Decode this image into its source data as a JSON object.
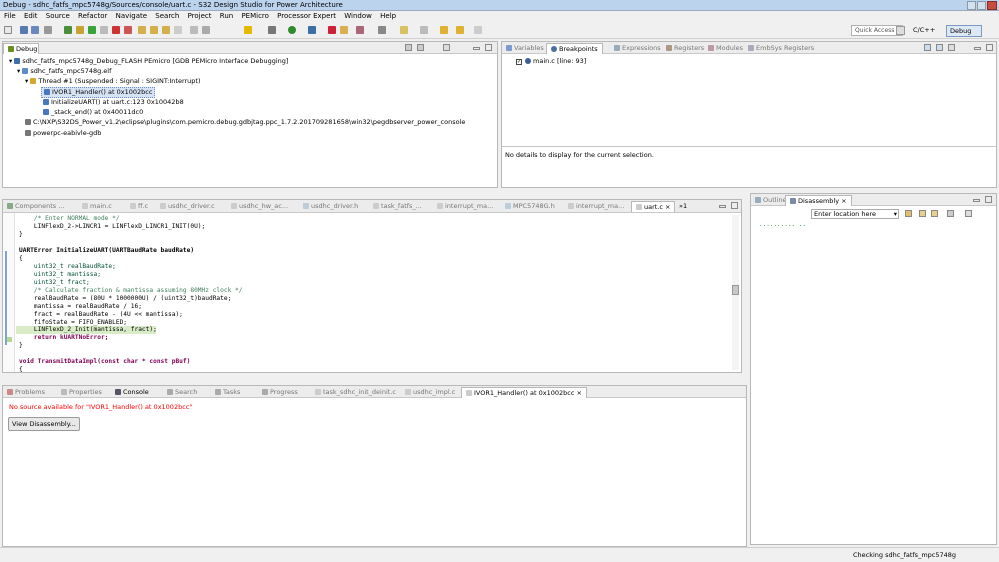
{
  "window": {
    "title": "Debug - sdhc_fatfs_mpc5748g/Sources/console/uart.c - S32 Design Studio for Power Architecture"
  },
  "menu": [
    "File",
    "Edit",
    "Source",
    "Refactor",
    "Navigate",
    "Search",
    "Project",
    "Run",
    "PEMicro",
    "Processor Expert",
    "Window",
    "Help"
  ],
  "toolbar": {
    "quick_access": "Quick Access",
    "perspectives": [
      "C/C++",
      "Debug"
    ]
  },
  "debug_view": {
    "tab": "Debug",
    "tree": [
      "sdhc_fatfs_mpc5748g_Debug_FLASH PEmicro [GDB PEMicro Interface Debugging]",
      "sdhc_fatfs_mpc5748g.elf",
      "Thread #1 (Suspended : Signal : SIGINT:Interrupt)",
      "IVOR1_Handler() at 0x1002bcc",
      "InitializeUART() at uart.c:123 0x10042b8",
      "_stack_end() at 0x40011dc0",
      "C:\\NXP\\S32DS_Power_v1.2\\eclipse\\plugins\\com.pemicro.debug.gdbjtag.ppc_1.7.2.201709281658\\win32\\pegdbserver_power_console",
      "powerpc-eabivle-gdb"
    ]
  },
  "right_top": {
    "tabs": [
      "Variables",
      "Breakpoints",
      "Expressions",
      "Registers",
      "Modules",
      "EmbSys Registers"
    ],
    "breakpoint": "main.c [line: 93]",
    "details": "No details to display for the current selection."
  },
  "editor": {
    "tabs": [
      "Components ...",
      "main.c",
      "ff.c",
      "usdhc_driver.c",
      "usdhc_hw_ac...",
      "usdhc_driver.h",
      "task_fatfs_...",
      "interrupt_ma...",
      "MPC5748G.h",
      "interrupt_ma...",
      "uart.c",
      "»1"
    ],
    "lines": [
      "    /* Enter NORMAL mode */",
      "    LINFlexD_2->LINCR1 = LINFlexD_LINCR1_INIT(0U);",
      "}",
      "",
      "UARTError InitializeUART(UARTBaudRate baudRate)",
      "{",
      "    uint32_t realBaudRate;",
      "    uint32_t mantissa;",
      "    uint32_t fract;",
      "    /* Calculate fraction & mantissa assuming 80MHz clock */",
      "    realBaudRate = (80U * 1000000U) / (uint32_t)baudRate;",
      "    mantissa = realBaudRate / 16;",
      "    fract = realBaudRate - (4U << mantissa);",
      "    fifoState = FIFO_ENABLED;",
      "    LINFlexD_2_Init(mantissa, fract);",
      "    return kUARTNoError;",
      "}",
      "",
      "void TransmitDataImpl(const char * const pBuf)",
      "{"
    ]
  },
  "outline": {
    "tabs": [
      "Outline",
      "Disassembly"
    ],
    "location_placeholder": "Enter location here",
    "dots": ".......... .."
  },
  "console": {
    "tabs": [
      "Problems",
      "Properties",
      "Console",
      "Search",
      "Tasks",
      "Progress",
      "task_sdhc_init_deinit.c",
      "usdhc_impl.c",
      "IVOR1_Handler() at 0x1002bcc"
    ],
    "message": "No source available for \"IVOR1_Handler() at 0x1002bcc\"",
    "button": "View Disassembly..."
  },
  "status": {
    "text": "Checking sdhc_fatfs_mpc5748g"
  },
  "colors": {
    "title_bg": "#bcd3ee",
    "selection": "#d5e3f5",
    "current_line": "#d9ecc8"
  }
}
